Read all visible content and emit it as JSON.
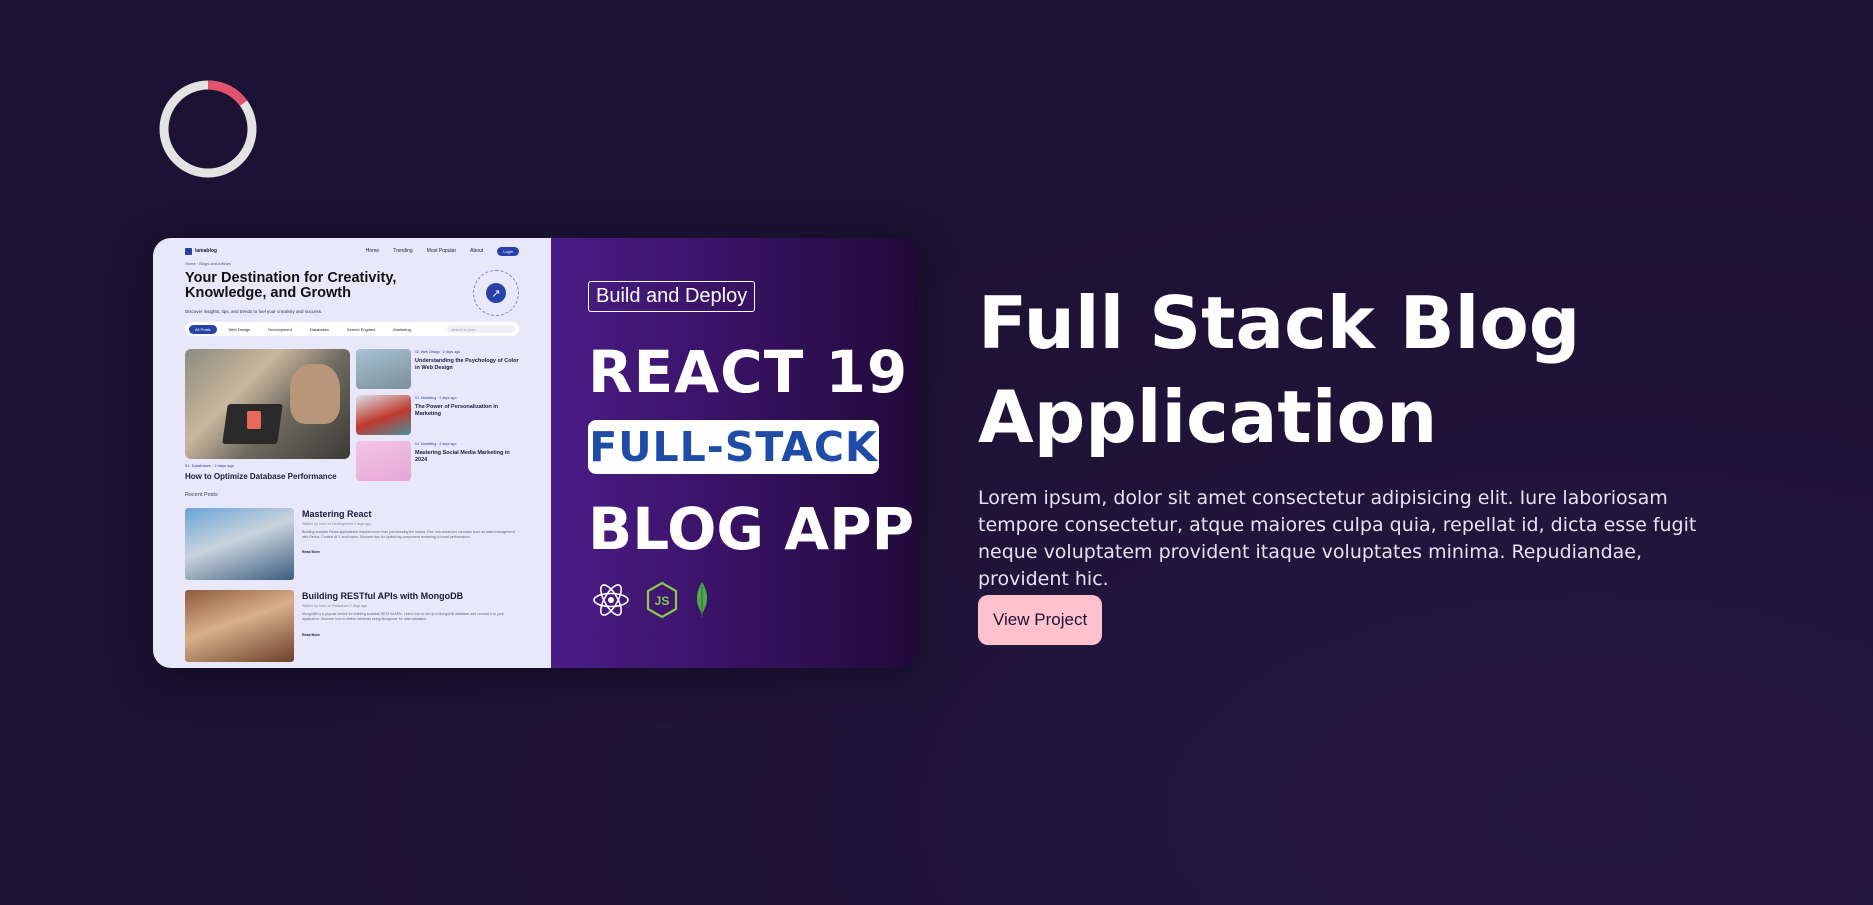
{
  "loader": {
    "progress_fraction": 0.15,
    "track_color": "#e3e3e3",
    "accent_color": "#e0536b"
  },
  "card": {
    "screenshot": {
      "brand": "lamablog",
      "nav": [
        "Home",
        "Trending",
        "Most Popular",
        "About"
      ],
      "login_label": "Login",
      "breadcrumb": "Home  ›  Blogs and Articles",
      "title": "Your Destination for Creativity, Knowledge, and Growth",
      "subtitle": "Discover insights, tips, and trends to fuel your creativity and success.",
      "filters": [
        "All Posts",
        "Web Design",
        "Development",
        "Databases",
        "Search Engines",
        "Marketing"
      ],
      "search_placeholder": "search a post...",
      "featured": {
        "meta": "01.  Databases  ·  2 days ago",
        "title": "How to Optimize Database Performance"
      },
      "side_posts": [
        {
          "meta": "02.  Web Design  ·  2 days ago",
          "title": "Understanding the Psychology of Color in Web Design"
        },
        {
          "meta": "03.  Marketing  ·  2 days ago",
          "title": "The Power of Personalization in Marketing"
        },
        {
          "meta": "04.  Marketing  ·  2 days ago",
          "title": "Mastering Social Media Marketing in 2024"
        }
      ],
      "recent_label": "Recent Posts",
      "recent_posts": [
        {
          "title": "Mastering React",
          "meta": "Written by  John  on  Development  2 days ago",
          "body": "Building scalable React applications requires more than just knowing the basics. Dive into advanced concepts such as state management with Redux, Context API, and hooks. Discover tips for optimizing component rendering to boost performance.",
          "read_more": "Read More"
        },
        {
          "title": "Building RESTful APIs with MongoDB",
          "meta": "Written by  John  on  Databases  2 days ago",
          "body": "MongoDB is a popular choice for building scalable RESTful APIs. Learn how to set up a MongoDB database and connect it to your application. Discover how to define schemas using Mongoose for data validation.",
          "read_more": "Read More"
        }
      ]
    },
    "promo": {
      "tag": "Build and Deploy",
      "line1": "REACT 19",
      "line2": "FULL-STACK",
      "line3": "BLOG APP",
      "icons": [
        "react-icon",
        "nodejs-icon",
        "mongodb-icon"
      ]
    }
  },
  "project": {
    "title": "Full Stack Blog Application",
    "description": "Lorem ipsum, dolor sit amet consectetur adipisicing elit. Iure laboriosam tempore consectetur, atque maiores culpa quia, repellat id, dicta esse fugit neque voluptatem provident itaque voluptates minima. Repudiandae, provident hic.",
    "button_label": "View Project",
    "button_color": "#ffc2cc"
  },
  "colors": {
    "background": "#1c1233",
    "screenshot_accent": "#2942a8",
    "full_stack_text": "#1e4ca8"
  }
}
